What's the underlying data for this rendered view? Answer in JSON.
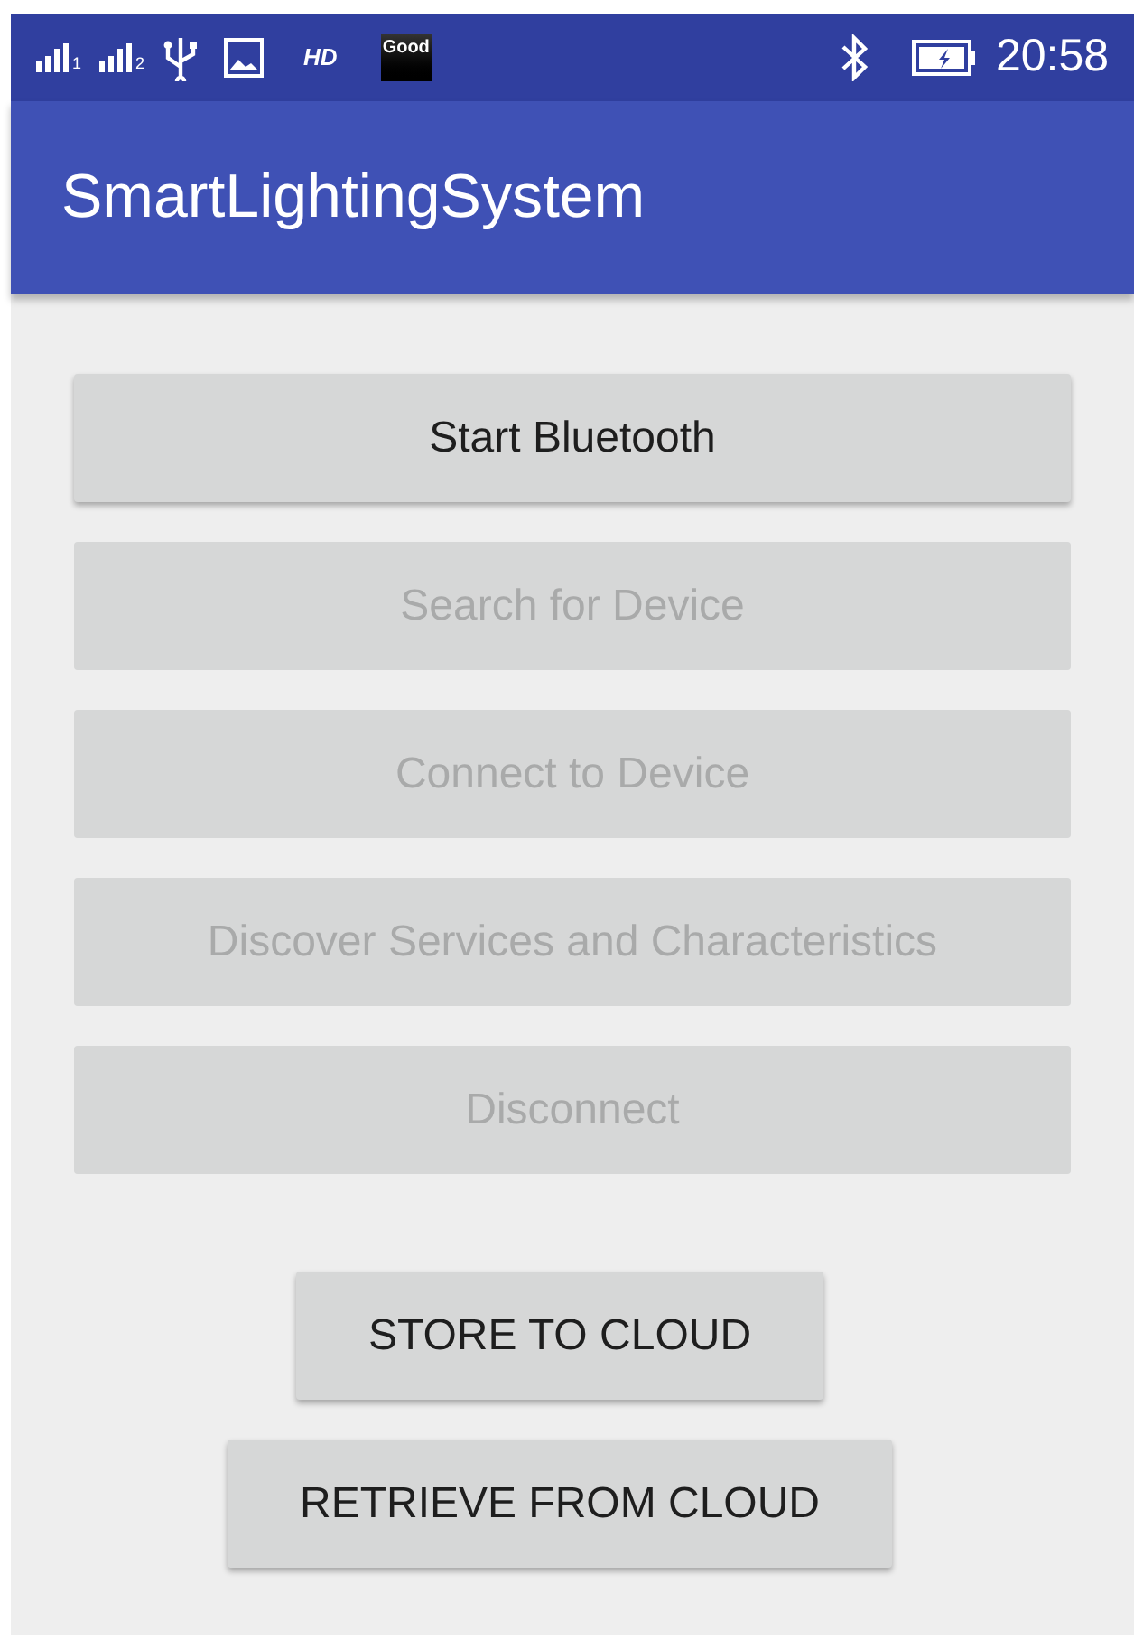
{
  "status_bar": {
    "sim_labels": [
      "1",
      "2"
    ],
    "hd": "HD",
    "badge": "Good",
    "time": "20:58"
  },
  "app_bar": {
    "title": "SmartLightingSystem"
  },
  "buttons": [
    {
      "label": "Start Bluetooth",
      "disabled": false
    },
    {
      "label": "Search for Device",
      "disabled": true
    },
    {
      "label": "Connect to Device",
      "disabled": true
    },
    {
      "label": "Discover Services and Characteristics",
      "disabled": true
    },
    {
      "label": "Disconnect",
      "disabled": true
    }
  ],
  "cloud_buttons": [
    {
      "label": "STORE TO CLOUD"
    },
    {
      "label": "RETRIEVE FROM CLOUD"
    }
  ]
}
